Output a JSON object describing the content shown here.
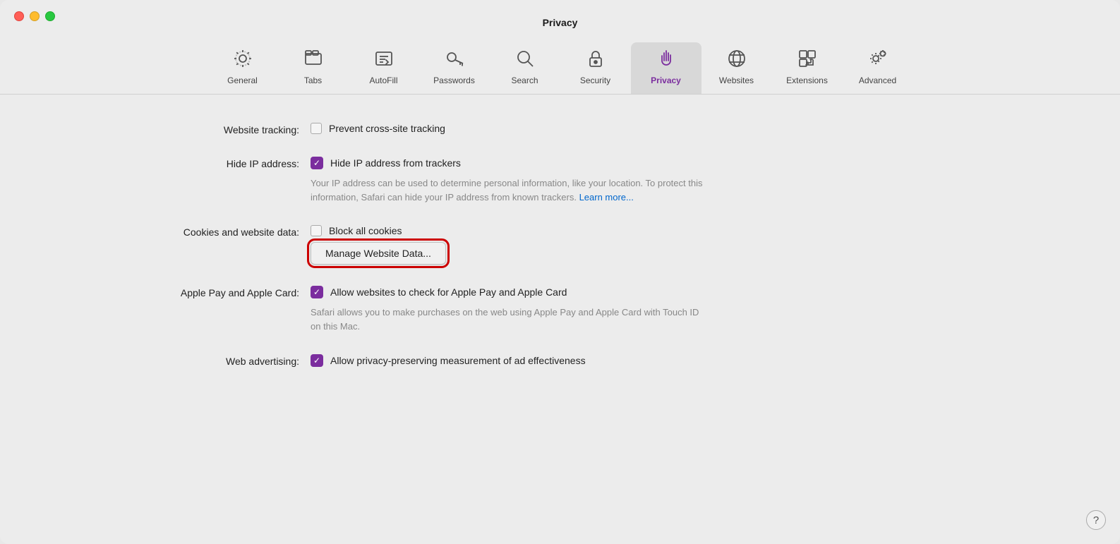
{
  "window": {
    "title": "Privacy"
  },
  "controls": {
    "close_label": "",
    "minimize_label": "",
    "maximize_label": ""
  },
  "toolbar": {
    "items": [
      {
        "id": "general",
        "label": "General",
        "icon": "gear"
      },
      {
        "id": "tabs",
        "label": "Tabs",
        "icon": "tabs"
      },
      {
        "id": "autofill",
        "label": "AutoFill",
        "icon": "autofill"
      },
      {
        "id": "passwords",
        "label": "Passwords",
        "icon": "key"
      },
      {
        "id": "search",
        "label": "Search",
        "icon": "search"
      },
      {
        "id": "security",
        "label": "Security",
        "icon": "lock"
      },
      {
        "id": "privacy",
        "label": "Privacy",
        "icon": "hand",
        "active": true
      },
      {
        "id": "websites",
        "label": "Websites",
        "icon": "globe"
      },
      {
        "id": "extensions",
        "label": "Extensions",
        "icon": "puzzle"
      },
      {
        "id": "advanced",
        "label": "Advanced",
        "icon": "advanced-gear"
      }
    ]
  },
  "settings": {
    "website_tracking": {
      "label": "Website tracking:",
      "checkbox_checked": false,
      "text": "Prevent cross-site tracking"
    },
    "hide_ip": {
      "label": "Hide IP address:",
      "checkbox_checked": true,
      "text": "Hide IP address from trackers",
      "description": "Your IP address can be used to determine personal information, like your location. To protect this information, Safari can hide your IP address from known trackers.",
      "learn_more": "Learn more..."
    },
    "cookies": {
      "label": "Cookies and website data:",
      "checkbox_checked": false,
      "text": "Block all cookies",
      "manage_btn_label": "Manage Website Data..."
    },
    "apple_pay": {
      "label": "Apple Pay and Apple Card:",
      "checkbox_checked": true,
      "text": "Allow websites to check for Apple Pay and Apple Card",
      "description": "Safari allows you to make purchases on the web using Apple Pay and Apple Card with Touch ID on this Mac."
    },
    "web_advertising": {
      "label": "Web advertising:",
      "checkbox_checked": true,
      "text": "Allow privacy-preserving measurement of ad effectiveness"
    }
  },
  "help": "?"
}
